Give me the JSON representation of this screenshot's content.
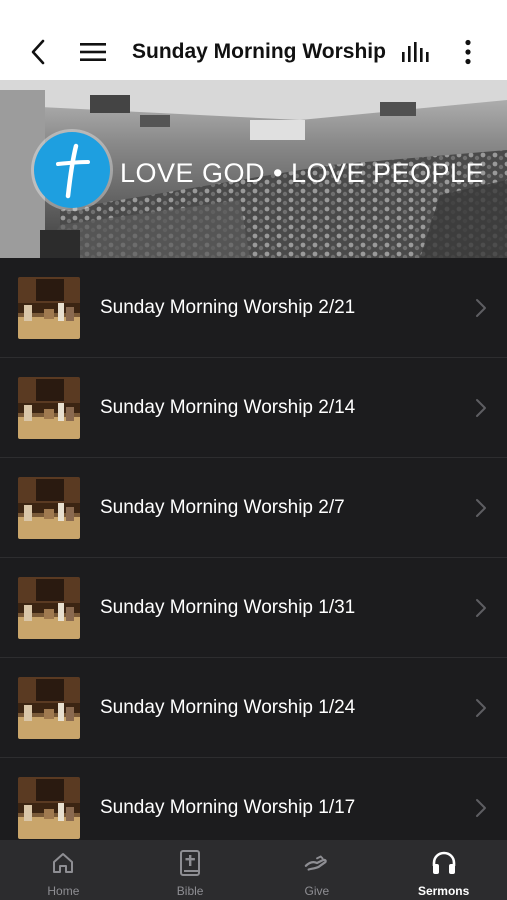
{
  "header": {
    "title": "Sunday Morning Worship",
    "back_icon": "chevron-left-icon",
    "menu_icon": "hamburger-menu-icon",
    "audio_icon": "audio-bars-icon",
    "more_icon": "vertical-ellipsis-icon"
  },
  "hero": {
    "tagline": "LOVE GOD • LOVE PEOPLE",
    "logo_icon": "cross-logo-icon",
    "logo_color": "#1e9fe0"
  },
  "sermons": [
    {
      "title": "Sunday Morning Worship 2/21"
    },
    {
      "title": "Sunday Morning Worship 2/14"
    },
    {
      "title": "Sunday Morning Worship 2/7"
    },
    {
      "title": "Sunday Morning Worship 1/31"
    },
    {
      "title": "Sunday Morning Worship 1/24"
    },
    {
      "title": "Sunday Morning Worship 1/17"
    }
  ],
  "tabbar": {
    "active": "Sermons",
    "tabs": [
      {
        "label": "Home",
        "icon": "home-icon"
      },
      {
        "label": "Bible",
        "icon": "bible-icon"
      },
      {
        "label": "Give",
        "icon": "give-hand-icon"
      },
      {
        "label": "Sermons",
        "icon": "headphones-icon"
      }
    ]
  },
  "colors": {
    "list_background": "#1c1c1e",
    "tabbar_background": "#2c2c2e",
    "active_tab": "#ffffff",
    "inactive_tab": "#8e8e93"
  }
}
